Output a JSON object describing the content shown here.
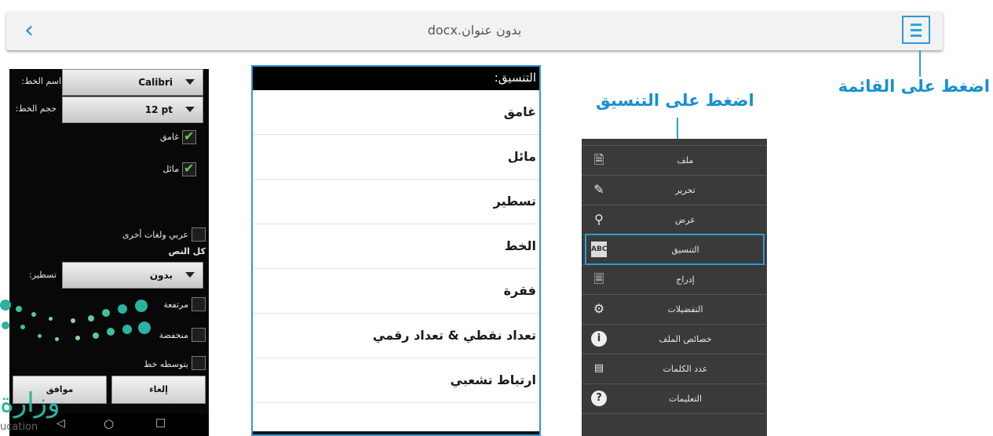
{
  "topbar": {
    "title": "بدون عنوان.docx",
    "back_icon": "chevron-left-icon",
    "menu_icon": "hamburger-menu-icon",
    "accent": "#2e9ad8"
  },
  "callouts": {
    "menu": "اضغط على القائمة",
    "format": "اضغط على التنسيق"
  },
  "phone": {
    "font_label": "اسم الخط:",
    "font_value": "Calibri",
    "size_label": "حجم الخط:",
    "size_value": "12 pt",
    "bold_label": "غامق",
    "bold_checked": true,
    "italic_label": "مائل",
    "italic_checked": true,
    "arabic_label": "عربي ولغات أخرى",
    "arabic_checked": false,
    "section_label": "كل النص",
    "underline_label": "تسطير:",
    "underline_value": "بدون",
    "superscript_label": "مرتفعة",
    "subscript_label": "منخفضة",
    "strike_label": "يتوسطه خط",
    "cancel_label": "إلغاء",
    "ok_label": "موافق",
    "nav_back": "◁",
    "nav_home": "○",
    "nav_recent": "□"
  },
  "format_panel": {
    "header": "التنسيق:",
    "items": [
      "غامق",
      "مائل",
      "تسطير",
      "الخط",
      "فقرة",
      "تعداد نقطي & تعداد رقمي",
      "ارتباط تشعبي"
    ]
  },
  "menu": {
    "items": [
      {
        "label": "ملف",
        "icon": "file-icon"
      },
      {
        "label": "تحرير",
        "icon": "pencil-icon"
      },
      {
        "label": "عرض",
        "icon": "search-icon"
      },
      {
        "label": "التنسيق",
        "icon": "format-abc-icon"
      },
      {
        "label": "إدراج",
        "icon": "insert-icon"
      },
      {
        "label": "التفضيلات",
        "icon": "gear-icon"
      },
      {
        "label": "خصائص الملف",
        "icon": "info-icon"
      },
      {
        "label": "عدد الكلمات",
        "icon": "word-count-icon"
      },
      {
        "label": "التعليمات",
        "icon": "help-icon"
      }
    ],
    "highlighted_index": 3
  },
  "logo": {
    "text": "وزارة",
    "sub": "ucation",
    "color": "#2bb3a1"
  }
}
